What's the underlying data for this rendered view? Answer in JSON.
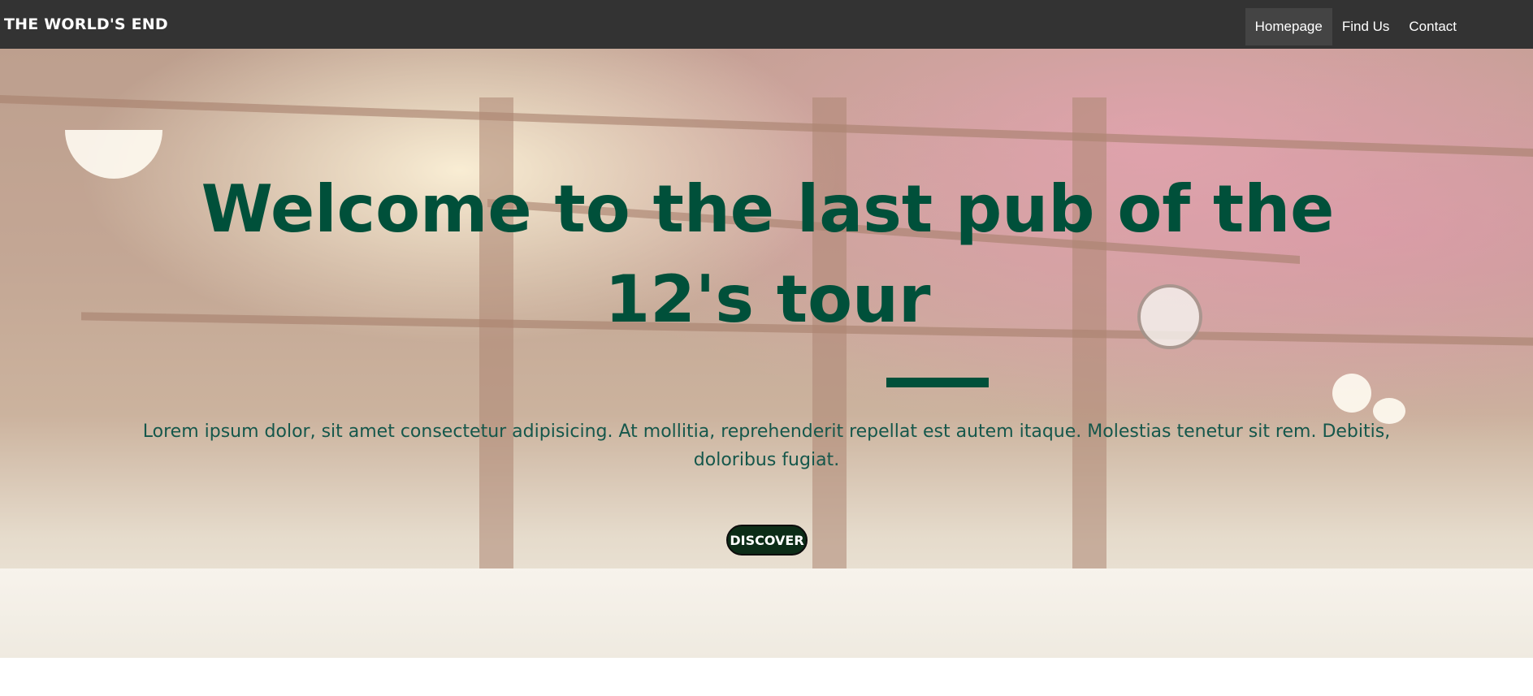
{
  "navbar": {
    "brand": "THE WORLD'S END",
    "links": [
      {
        "label": "Homepage",
        "active": true
      },
      {
        "label": "Find Us",
        "active": false
      },
      {
        "label": "Contact",
        "active": false
      }
    ]
  },
  "hero": {
    "title": "Welcome to the last pub of the 12's tour",
    "text": "Lorem ipsum dolor, sit amet consectetur adipisicing. At mollitia, reprehenderit repellat est autem itaque. Molestias tenetur sit rem. Debitis, doloribus fugiat.",
    "button_label": "DISCOVER"
  },
  "colors": {
    "navbar_bg": "#333333",
    "accent_green": "#00503a",
    "button_bg": "#0c2c17"
  }
}
